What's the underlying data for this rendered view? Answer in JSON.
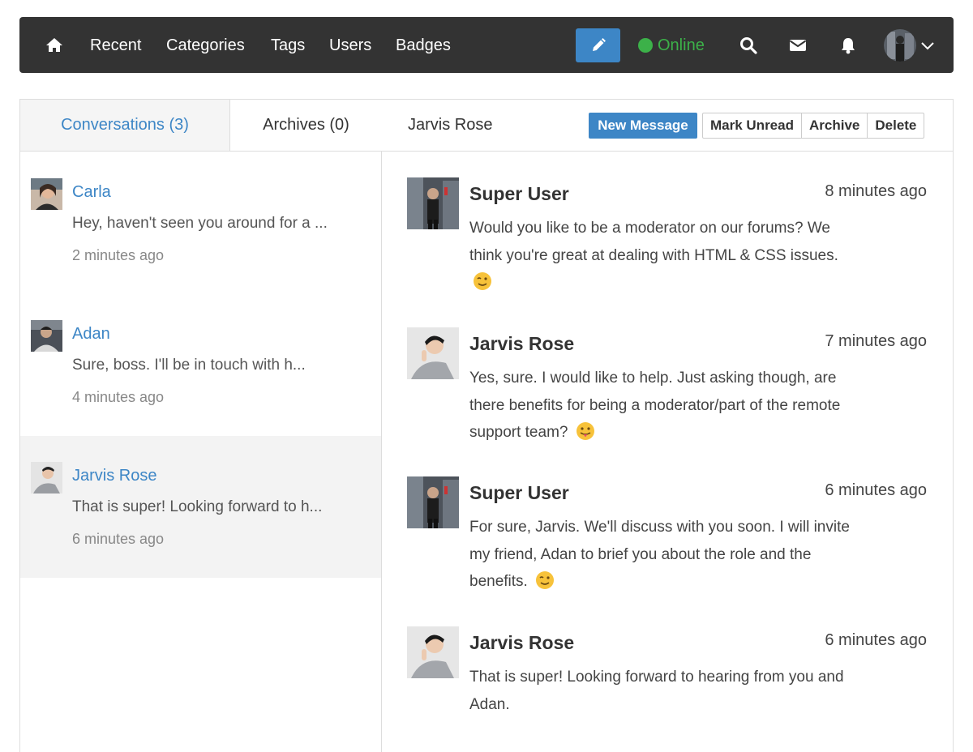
{
  "nav": {
    "links": [
      "Recent",
      "Categories",
      "Tags",
      "Users",
      "Badges"
    ],
    "status": "Online",
    "colors": {
      "bar": "#333333",
      "accent": "#3d86c6",
      "online": "#3cb149"
    }
  },
  "tabs": {
    "conversations": "Conversations (3)",
    "archives": "Archives (0)"
  },
  "conversations": [
    {
      "name": "Carla",
      "snippet": "Hey, haven't seen you around for a ...",
      "time": "2 minutes ago",
      "selected": false
    },
    {
      "name": "Adan",
      "snippet": "Sure, boss. I'll be in touch with h...",
      "time": "4 minutes ago",
      "selected": false
    },
    {
      "name": "Jarvis Rose",
      "snippet": "That is super! Looking forward to h...",
      "time": "6 minutes ago",
      "selected": true
    }
  ],
  "thread": {
    "recipient": "Jarvis Rose",
    "actions": {
      "new_message": "New Message",
      "mark_unread": "Mark Unread",
      "archive": "Archive",
      "delete": "Delete"
    },
    "messages": [
      {
        "author": "Super User",
        "time": "8 minutes ago",
        "body": "Would you like to be a moderator on our forums? We think you're great at dealing with HTML & CSS issues.",
        "emoji": "wink-emoji"
      },
      {
        "author": "Jarvis Rose",
        "time": "7 minutes ago",
        "body": "Yes, sure. I would like to help. Just asking though, are there benefits for being a moderator/part of the remote support team?",
        "emoji": "tongue-emoji"
      },
      {
        "author": "Super User",
        "time": "6 minutes ago",
        "body": "For sure, Jarvis. We'll discuss with you soon. I will invite my friend, Adan to brief you about the role and the benefits.",
        "emoji": "wink-emoji"
      },
      {
        "author": "Jarvis Rose",
        "time": "6 minutes ago",
        "body": "That is super! Looking forward to hearing from you and Adan.",
        "emoji": ""
      }
    ]
  }
}
